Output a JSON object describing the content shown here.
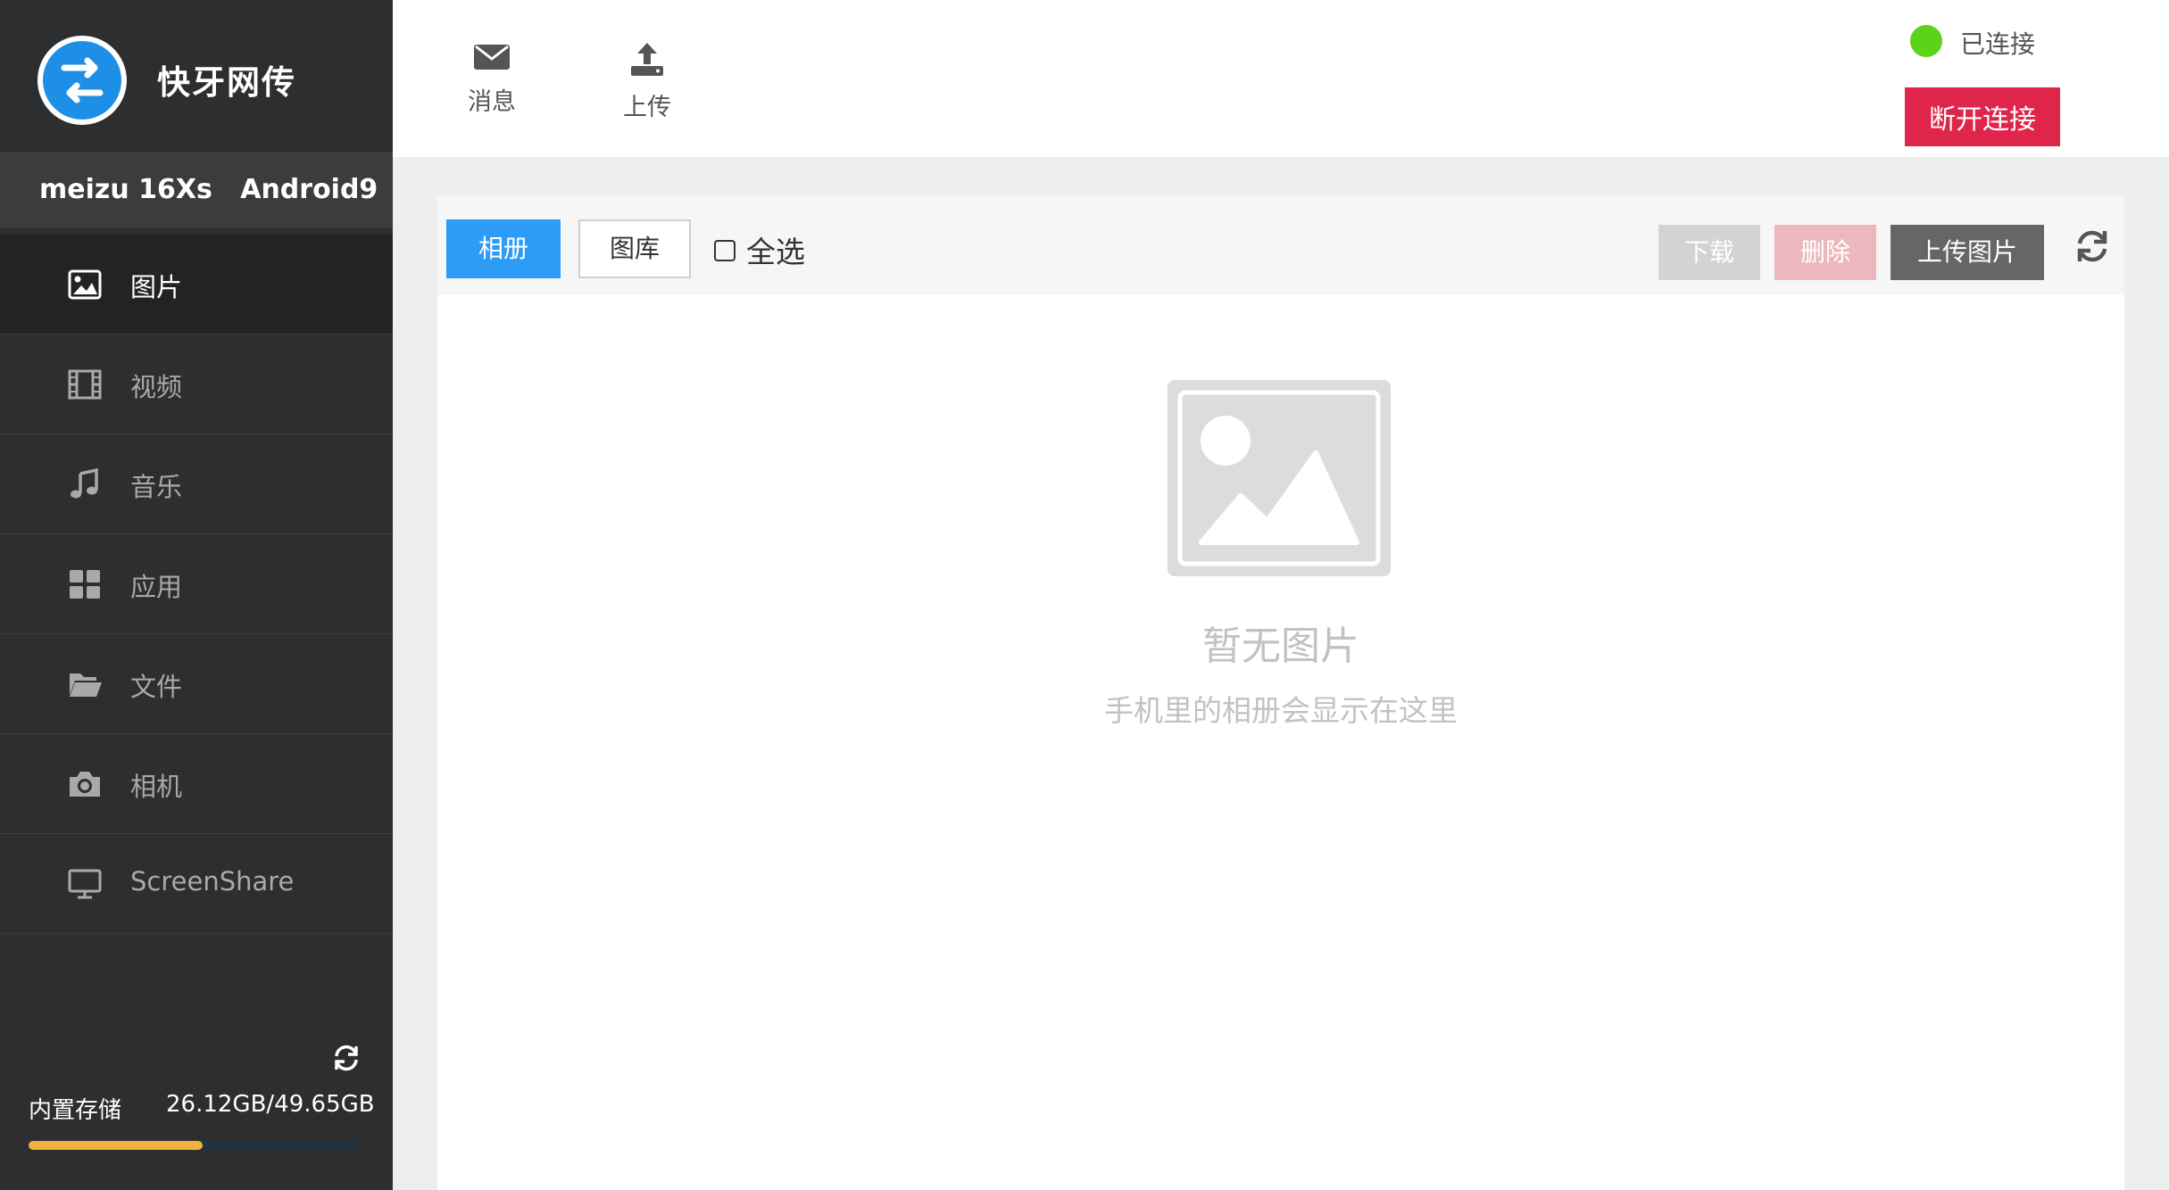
{
  "app": {
    "name": "快牙网传"
  },
  "device": {
    "label": "meizu 16Xs   Android9"
  },
  "sidebar": {
    "items": [
      {
        "label": "图片",
        "icon": "image-icon",
        "active": true
      },
      {
        "label": "视频",
        "icon": "film-icon",
        "active": false
      },
      {
        "label": "音乐",
        "icon": "music-icon",
        "active": false
      },
      {
        "label": "应用",
        "icon": "apps-grid-icon",
        "active": false
      },
      {
        "label": "文件",
        "icon": "folder-icon",
        "active": false
      },
      {
        "label": "相机",
        "icon": "camera-icon",
        "active": false
      },
      {
        "label": "ScreenShare",
        "icon": "monitor-icon",
        "active": false
      }
    ]
  },
  "storage": {
    "label": "内置存储",
    "value": "26.12GB/49.65GB",
    "used_fraction": 0.526,
    "fill_color": "#f2b33e"
  },
  "topbar": {
    "tools": [
      {
        "label": "消息",
        "icon": "envelope-icon"
      },
      {
        "label": "上传",
        "icon": "upload-icon"
      }
    ],
    "status_text": "已连接",
    "status_color": "#5bd316",
    "disconnect_label": "断开连接"
  },
  "panel": {
    "tab_album": "相册",
    "tab_gallery": "图库",
    "select_all": "全选",
    "download": "下载",
    "delete": "删除",
    "upload_image": "上传图片",
    "empty_title": "暂无图片",
    "empty_subtitle": "手机里的相册会显示在这里"
  },
  "colors": {
    "accent": "#2d9cf6",
    "danger": "#e0254a",
    "sidebar_bg": "#2c2e30"
  }
}
